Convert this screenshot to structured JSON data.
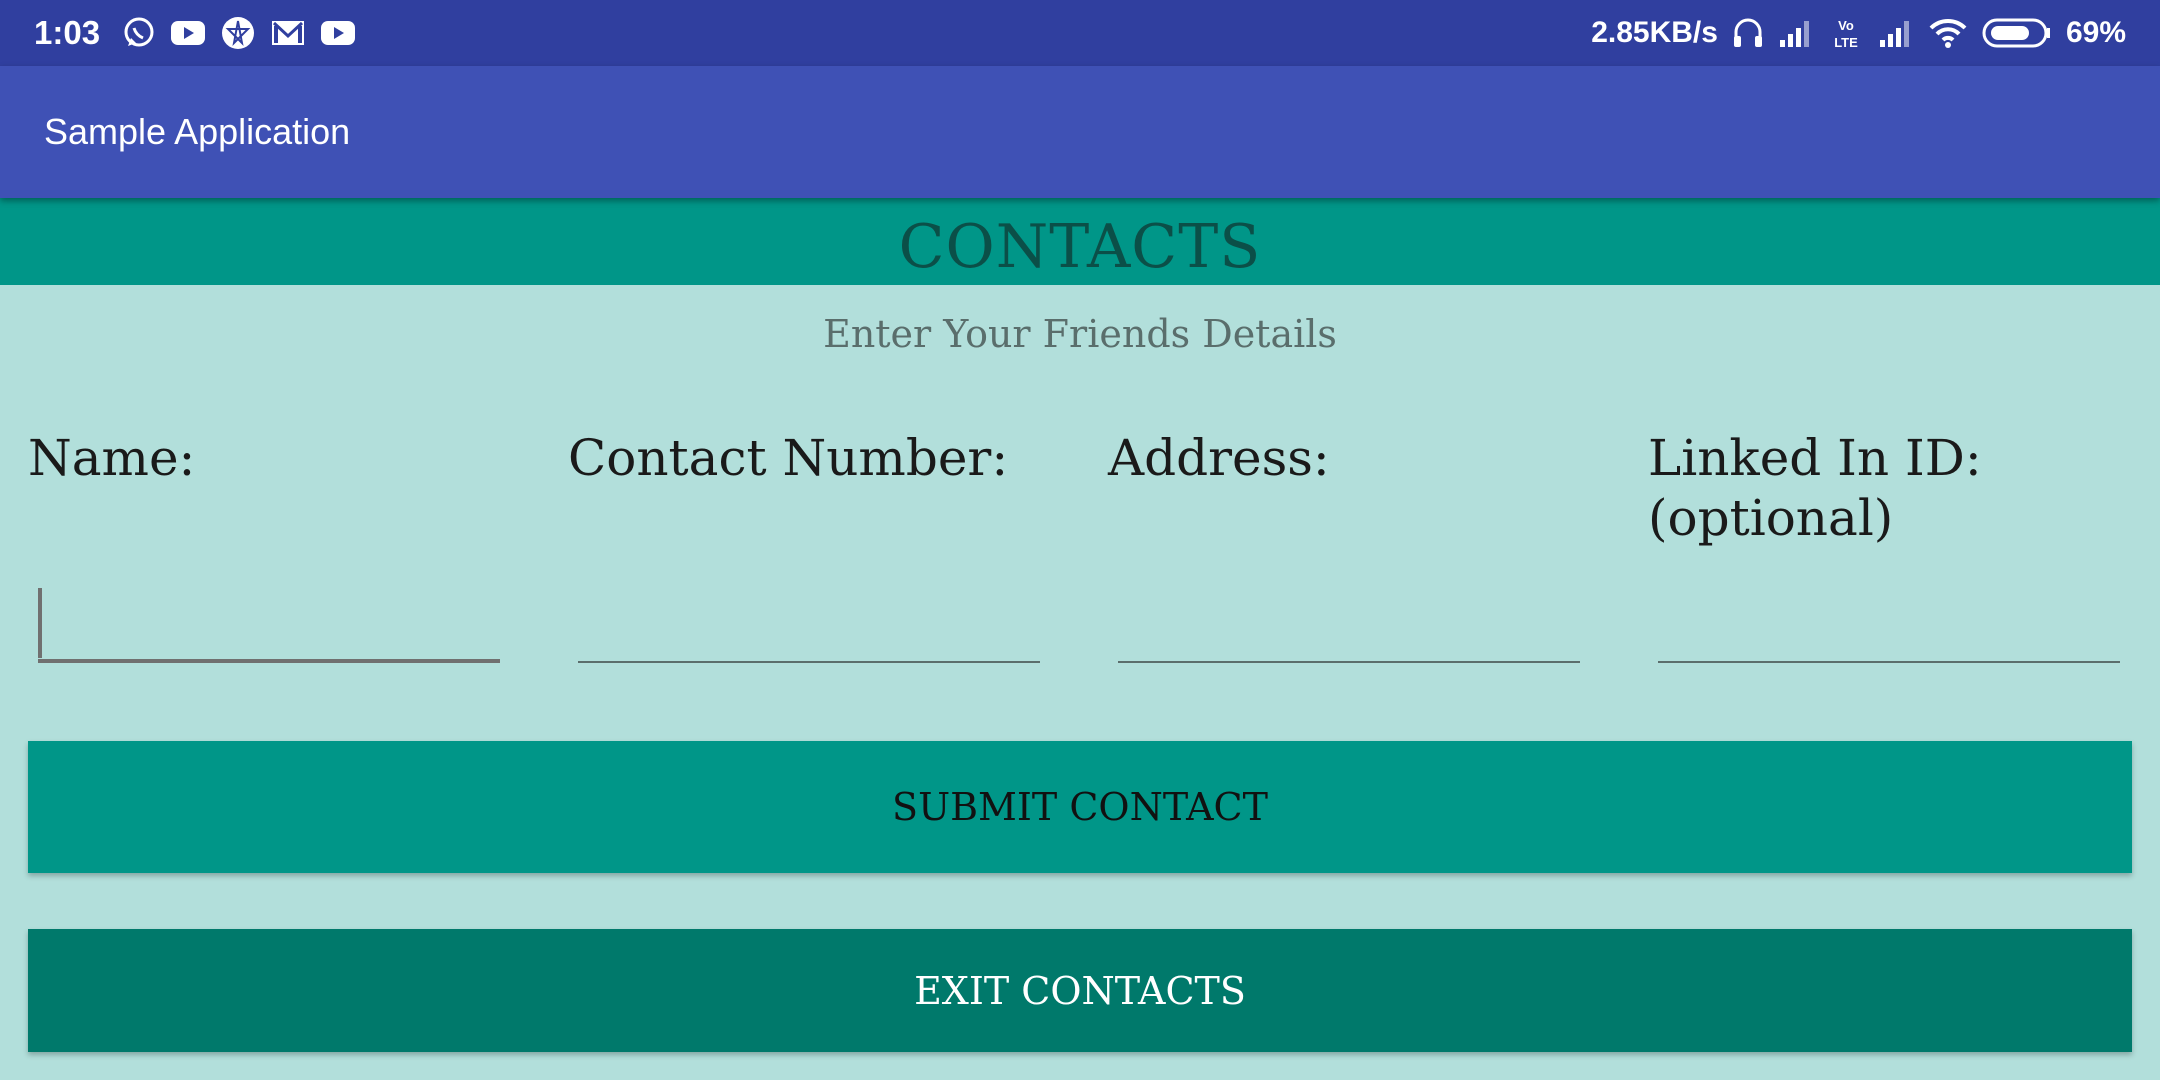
{
  "status_bar": {
    "time": "1:03",
    "net_speed": "2.85KB/s",
    "battery_percent": "69%",
    "left_icons": [
      "whatsapp-icon",
      "youtube-icon",
      "app-icon",
      "gmail-icon",
      "youtube-icon"
    ],
    "right_icons": [
      "headphones-icon",
      "signal-icon",
      "volte-icon",
      "signal-icon",
      "wifi-icon",
      "battery-icon"
    ],
    "volte_text": "Vo LTE"
  },
  "app_bar": {
    "title": "Sample Application"
  },
  "banner": {
    "title": "CONTACTS"
  },
  "subtitle": "Enter Your Friends Details",
  "fields": [
    {
      "label": "Name:",
      "value": ""
    },
    {
      "label": "Contact Number:",
      "value": ""
    },
    {
      "label": "Address:",
      "value": ""
    },
    {
      "label": "Linked In ID: (optional)",
      "value": ""
    }
  ],
  "buttons": {
    "submit": "SUBMIT CONTACT",
    "exit": "EXIT CONTACTS"
  },
  "colors": {
    "status_bar": "#303f9f",
    "app_bar": "#3f51b5",
    "banner": "#009688",
    "background": "#b2dfdb",
    "submit_button": "#009688",
    "exit_button": "#00796b"
  }
}
